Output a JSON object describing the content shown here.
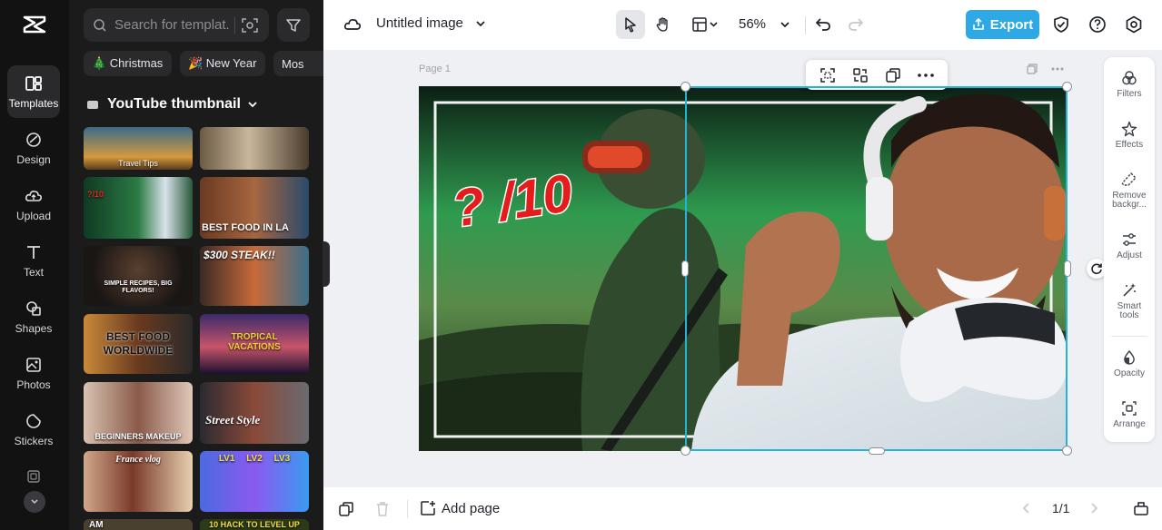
{
  "rail": {
    "items": [
      {
        "label": "Templates"
      },
      {
        "label": "Design"
      },
      {
        "label": "Upload"
      },
      {
        "label": "Text"
      },
      {
        "label": "Shapes"
      },
      {
        "label": "Photos"
      },
      {
        "label": "Stickers"
      }
    ]
  },
  "panel": {
    "search_placeholder": "Search for templat...",
    "chips": [
      "🎄 Christmas",
      "🎉 New Year",
      "Mos"
    ],
    "category_title": "YouTube thumbnail",
    "thumbs": [
      {
        "text": "Travel Tips"
      },
      {
        "text": ""
      },
      {
        "text": "?/10"
      },
      {
        "text": "BEST FOOD IN LA"
      },
      {
        "text": "SIMPLE RECIPES, BIG FLAVORS!"
      },
      {
        "text": "$300 STEAK!!"
      },
      {
        "text": "BEST FOOD WORLDWIDE"
      },
      {
        "text": "TROPICAL VACATIONS"
      },
      {
        "text": "BEGINNERS MAKEUP"
      },
      {
        "text": "Street Style"
      },
      {
        "text": "France vlog"
      },
      {
        "text": "LV1 LV2 LV3"
      },
      {
        "text": "AM"
      },
      {
        "text": "10 HACK TO LEVEL UP"
      }
    ]
  },
  "topbar": {
    "title": "Untitled image",
    "zoom": "56%",
    "export_label": "Export"
  },
  "canvas": {
    "page_label": "Page 1",
    "overlay_text": "? /10"
  },
  "props": {
    "items": [
      {
        "label": "Filters"
      },
      {
        "label": "Effects"
      },
      {
        "label": "Remove backgr..."
      },
      {
        "label": "Adjust"
      },
      {
        "label": "Smart tools"
      },
      {
        "label": "Opacity"
      },
      {
        "label": "Arrange"
      }
    ]
  },
  "bottombar": {
    "add_page_label": "Add page",
    "pager": "1/1"
  },
  "colors": {
    "accent": "#2fa8e6",
    "selection": "#23b3d6"
  }
}
